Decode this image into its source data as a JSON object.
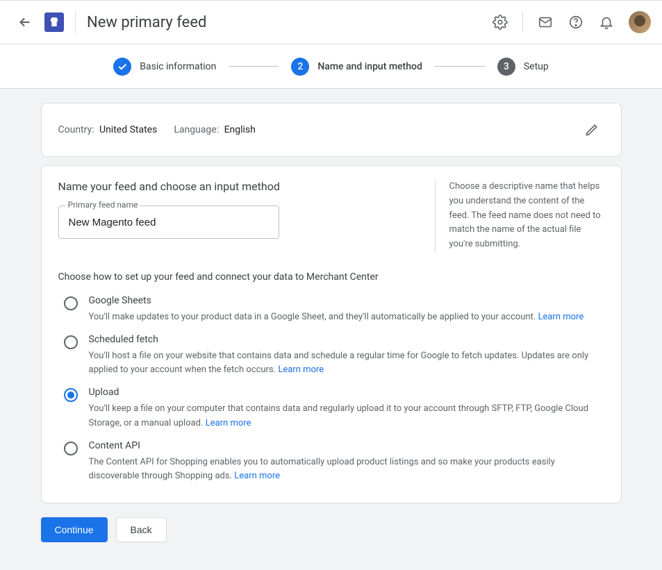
{
  "header": {
    "title": "New primary feed"
  },
  "stepper": {
    "steps": [
      {
        "label": "Basic information",
        "state": "done"
      },
      {
        "label": "Name and input method",
        "state": "active",
        "num": "2"
      },
      {
        "label": "Setup",
        "state": "todo",
        "num": "3"
      }
    ]
  },
  "summary": {
    "country_label": "Country:",
    "country_value": "United States",
    "language_label": "Language:",
    "language_value": "English"
  },
  "main": {
    "heading": "Name your feed and choose an input method",
    "field_label": "Primary feed name",
    "field_value": "New Magento feed",
    "help_text": "Choose a descriptive name that helps you understand the content of the feed. The feed name does not need to match the name of the actual file you're submitting.",
    "choose_heading": "Choose how to set up your feed and connect your data to Merchant Center",
    "learn_more": "Learn more",
    "options": [
      {
        "title": "Google Sheets",
        "desc": "You'll make updates to your product data in a Google Sheet, and they'll automatically be applied to your account.",
        "selected": false
      },
      {
        "title": "Scheduled fetch",
        "desc": "You'll host a file on your website that contains data and schedule a regular time for Google to fetch updates. Updates are only applied to your account when the fetch occurs.",
        "selected": false
      },
      {
        "title": "Upload",
        "desc": "You'll keep a file on your computer that contains data and regularly upload it to your account through SFTP, FTP, Google Cloud Storage, or a manual upload.",
        "selected": true
      },
      {
        "title": "Content API",
        "desc": "The Content API for Shopping enables you to automatically upload product listings and so make your products easily discoverable through Shopping ads.",
        "selected": false
      }
    ]
  },
  "buttons": {
    "continue": "Continue",
    "back": "Back"
  }
}
